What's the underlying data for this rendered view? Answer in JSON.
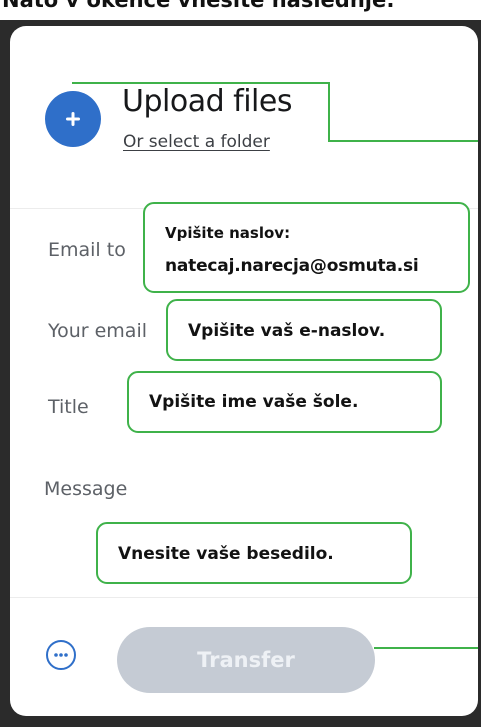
{
  "caption": "Nato v okence vnesite naslednje:",
  "upload": {
    "icon": "plus-icon",
    "title": "Upload files",
    "folder_link": "Or select a folder"
  },
  "form": {
    "email_to_label": "Email to",
    "your_email_label": "Your email",
    "title_label": "Title",
    "message_label": "Message"
  },
  "annotations": {
    "email_to_line1": "Vpišite naslov:",
    "email_to_line2": "natecaj.narecja@osmuta.si",
    "your_email": "Vpišite vaš e-naslov.",
    "title": "Vpišite ime vaše šole.",
    "message": "Vnesite vaše besedilo."
  },
  "footer": {
    "more_icon": "ellipsis-icon",
    "transfer_label": "Transfer"
  },
  "colors": {
    "accent_blue": "#2f6fc9",
    "annotation_green": "#3fb24a",
    "disabled_button": "#c5cbd4",
    "frame_dark": "#2b2b2b"
  }
}
